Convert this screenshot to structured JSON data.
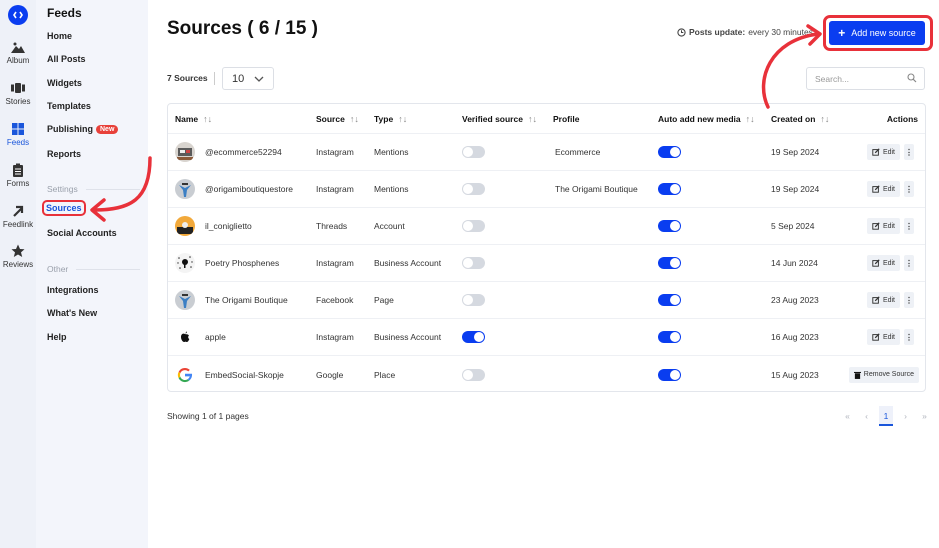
{
  "rail": {
    "items": [
      {
        "label": "Album",
        "icon": "mountain-icon"
      },
      {
        "label": "Stories",
        "icon": "stories-icon"
      },
      {
        "label": "Feeds",
        "icon": "grid-icon",
        "active": true
      },
      {
        "label": "Forms",
        "icon": "clipboard-icon"
      },
      {
        "label": "Feedlink",
        "icon": "arrow-up-right-icon"
      },
      {
        "label": "Reviews",
        "icon": "star-icon"
      }
    ]
  },
  "menu": {
    "title": "Feeds",
    "items": [
      "Home",
      "All Posts",
      "Widgets",
      "Templates",
      "Publishing",
      "Reports"
    ],
    "publishing_badge": "New",
    "settings_label": "Settings",
    "settings_items": [
      "Sources",
      "Social Accounts"
    ],
    "other_label": "Other",
    "other_items": [
      "Integrations",
      "What's New",
      "Help"
    ]
  },
  "header": {
    "title": "Sources ( 6 / 15 )",
    "posts_update_label": "Posts update:",
    "posts_update_value": "every 30 minutes",
    "add_button": "Add new source"
  },
  "toolbar": {
    "count": "7 Sources",
    "per_page": "10",
    "search_placeholder": "Search..."
  },
  "table": {
    "columns": [
      "Name",
      "Source",
      "Type",
      "Verified source",
      "Profile",
      "Auto add new media",
      "Created on",
      "Actions"
    ],
    "rows": [
      {
        "name": "@ecommerce52294",
        "source": "Instagram",
        "type": "Mentions",
        "verified": false,
        "profile": "Ecommerce",
        "auto_add": true,
        "created": "19 Sep 2024",
        "action": "Edit"
      },
      {
        "name": "@origamiboutiquestore",
        "source": "Instagram",
        "type": "Mentions",
        "verified": false,
        "profile": "The Origami Boutique",
        "auto_add": true,
        "created": "19 Sep 2024",
        "action": "Edit"
      },
      {
        "name": "il_coniglietto",
        "source": "Threads",
        "type": "Account",
        "verified": false,
        "profile": "",
        "auto_add": true,
        "created": "5 Sep 2024",
        "action": "Edit"
      },
      {
        "name": "Poetry Phosphenes",
        "source": "Instagram",
        "type": "Business Account",
        "verified": false,
        "profile": "",
        "auto_add": true,
        "created": "14 Jun 2024",
        "action": "Edit"
      },
      {
        "name": "The Origami Boutique",
        "source": "Facebook",
        "type": "Page",
        "verified": false,
        "profile": "",
        "auto_add": true,
        "created": "23 Aug 2023",
        "action": "Edit"
      },
      {
        "name": "apple",
        "source": "Instagram",
        "type": "Business Account",
        "verified": true,
        "profile": "",
        "auto_add": true,
        "created": "16 Aug 2023",
        "action": "Edit"
      },
      {
        "name": "EmbedSocial-Skopje",
        "source": "Google",
        "type": "Place",
        "verified": false,
        "profile": "",
        "auto_add": true,
        "created": "15 Aug 2023",
        "action": "Remove Source"
      }
    ]
  },
  "footer": {
    "showing": "Showing 1 of 1 pages",
    "current_page": "1"
  },
  "colors": {
    "accent": "#0a3df0",
    "annotation": "#e8313a"
  }
}
